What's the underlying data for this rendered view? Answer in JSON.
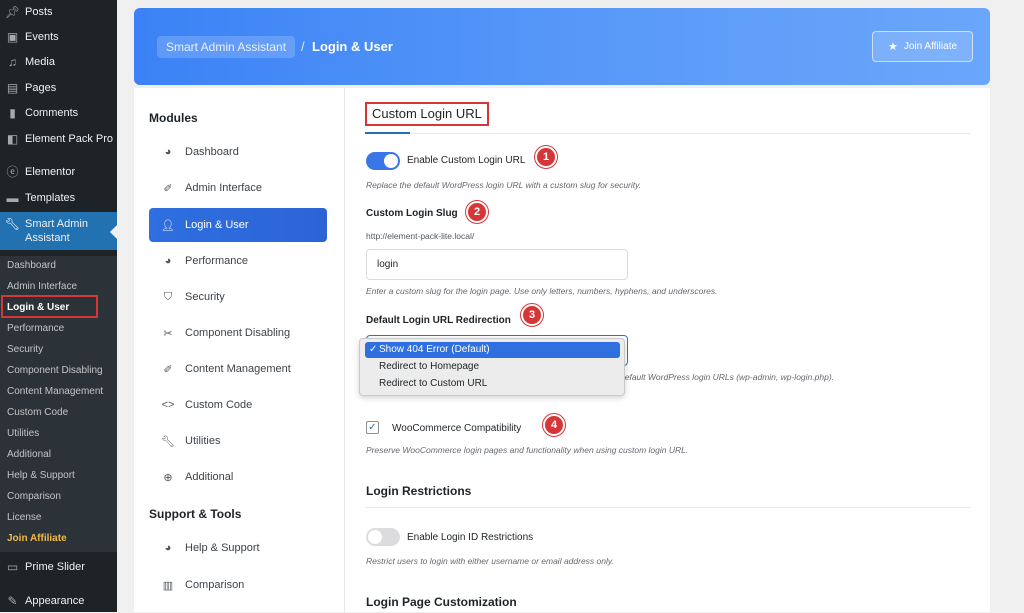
{
  "wp_sidebar": {
    "top_items": [
      {
        "label": "Posts",
        "icon": "pin-icon"
      },
      {
        "label": "Events",
        "icon": "calendar-icon"
      },
      {
        "label": "Media",
        "icon": "media-icon"
      },
      {
        "label": "Pages",
        "icon": "pages-icon"
      },
      {
        "label": "Comments",
        "icon": "comment-icon"
      },
      {
        "label": "Element Pack Pro",
        "icon": "element-pack-icon"
      },
      {
        "label": "Elementor",
        "icon": "elementor-icon"
      },
      {
        "label": "Templates",
        "icon": "folder-icon"
      },
      {
        "label": "Smart Admin Assistant",
        "icon": "wrench-icon"
      }
    ],
    "sub_items": [
      "Dashboard",
      "Admin Interface",
      "Login & User",
      "Performance",
      "Security",
      "Component Disabling",
      "Content Management",
      "Custom Code",
      "Utilities",
      "Additional",
      "Help & Support",
      "Comparison",
      "License",
      "Join Affiliate"
    ],
    "bottom_items": [
      {
        "label": "Prime Slider",
        "icon": "slider-icon"
      },
      {
        "label": "Appearance",
        "icon": "brush-icon"
      }
    ]
  },
  "header": {
    "breadcrumb_root": "Smart Admin Assistant",
    "separator": "/",
    "breadcrumb_current": "Login & User",
    "affiliate_button": "Join Affiliate"
  },
  "modules": {
    "title": "Modules",
    "items": [
      {
        "label": "Dashboard",
        "icon": "palette-icon"
      },
      {
        "label": "Admin Interface",
        "icon": "pin-icon"
      },
      {
        "label": "Login & User",
        "icon": "user-icon"
      },
      {
        "label": "Performance",
        "icon": "palette-icon"
      },
      {
        "label": "Security",
        "icon": "shield-icon"
      },
      {
        "label": "Component Disabling",
        "icon": "broom-icon"
      },
      {
        "label": "Content Management",
        "icon": "pin-icon"
      },
      {
        "label": "Custom Code",
        "icon": "code-icon"
      },
      {
        "label": "Utilities",
        "icon": "wrench-icon"
      },
      {
        "label": "Additional",
        "icon": "plus-circle-icon"
      }
    ],
    "tools_title": "Support & Tools",
    "tools": [
      {
        "label": "Help & Support",
        "icon": "palette-icon"
      },
      {
        "label": "Comparison",
        "icon": "bar-chart-icon"
      }
    ]
  },
  "settings": {
    "section_title": "Custom Login URL",
    "enable_label": "Enable Custom Login URL",
    "enable_desc": "Replace the default WordPress login URL with a custom slug for security.",
    "slug_label": "Custom Login Slug",
    "slug_prefix": "http://element-pack-lite.local/",
    "slug_value": "login",
    "slug_desc": "Enter a custom slug for the login page. Use only letters, numbers, hyphens, and underscores.",
    "redirect_label": "Default Login URL Redirection",
    "redirect_options": [
      "Show 404 Error (Default)",
      "Redirect to Homepage",
      "Redirect to Custom URL"
    ],
    "redirect_check": "✓",
    "redirect_desc": "default WordPress login URLs (wp-admin, wp-login.php).",
    "woo_label": "WooCommerce Compatibility",
    "woo_desc": "Preserve WooCommerce login pages and functionality when using custom login URL.",
    "restrictions_title": "Login Restrictions",
    "restrict_label": "Enable Login ID Restrictions",
    "restrict_desc": "Restrict users to login with either username or email address only.",
    "customization_title": "Login Page Customization",
    "badges": [
      "1",
      "2",
      "3",
      "4"
    ]
  },
  "colors": {
    "accent": "#2f6fe0",
    "highlight": "#d63638",
    "wp_dark": "#1d2327"
  }
}
